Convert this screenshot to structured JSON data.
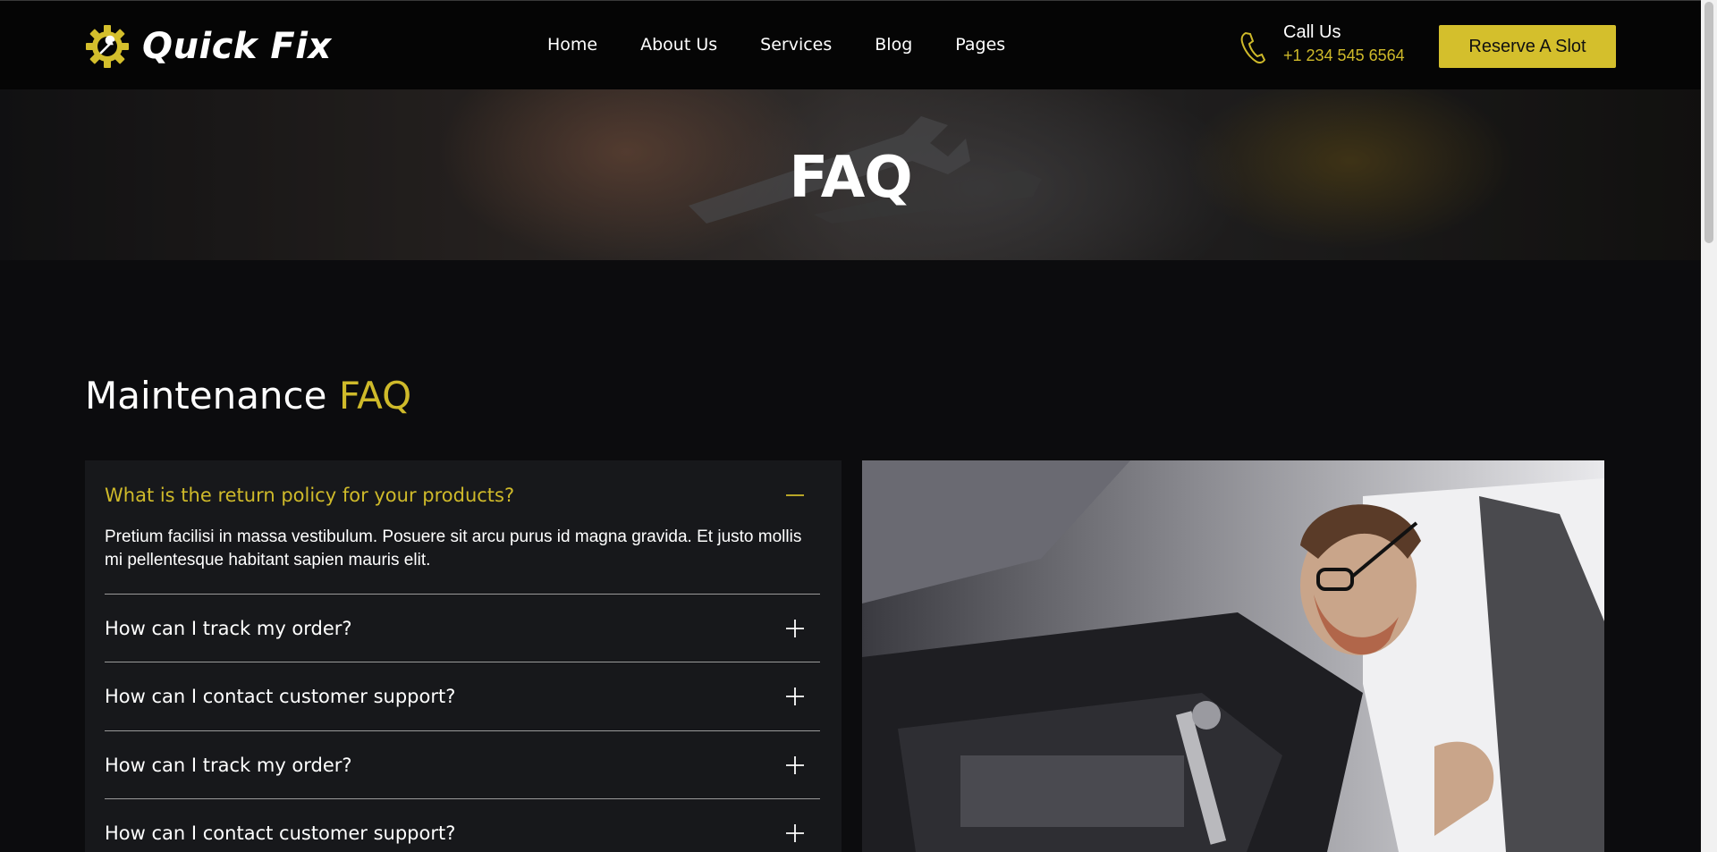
{
  "header": {
    "brand": "Quick Fix",
    "nav": [
      "Home",
      "About Us",
      "Services",
      "Blog",
      "Pages"
    ],
    "call_label": "Call Us",
    "call_number": "+1 234 545 6564",
    "reserve_label": "Reserve A Slot"
  },
  "hero": {
    "title": "FAQ"
  },
  "section": {
    "title_main": "Maintenance ",
    "title_accent": "FAQ"
  },
  "faq": {
    "items": [
      {
        "question": "What is the return policy for your products?",
        "answer": "Pretium facilisi in massa vestibulum. Posuere sit arcu purus id magna gravida. Et justo mollis mi pellentesque habitant sapien mauris elit.",
        "expanded": true
      },
      {
        "question": "How can I track my order?",
        "expanded": false
      },
      {
        "question": "How can I contact customer support?",
        "expanded": false
      },
      {
        "question": "How can I track my order?",
        "expanded": false
      },
      {
        "question": "How can I contact customer support?",
        "expanded": false
      }
    ]
  },
  "colors": {
    "accent": "#cfba2a",
    "background": "#0c0c0e",
    "panel": "#17181b"
  },
  "icons": [
    "gear-wrench-logo-icon",
    "phone-icon",
    "minus-icon",
    "plus-icon"
  ]
}
